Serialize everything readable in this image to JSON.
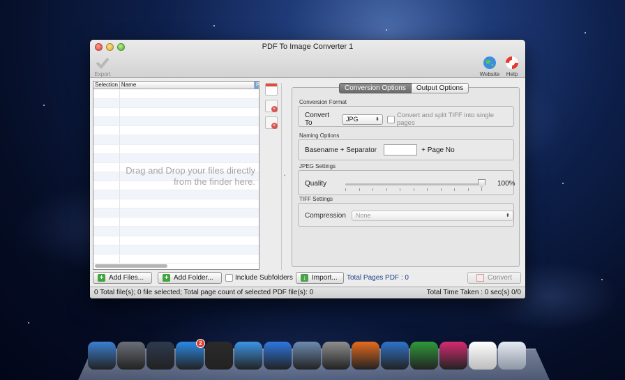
{
  "window": {
    "title": "PDF To Image Converter 1"
  },
  "toolbar": {
    "export_label": "Export",
    "website_label": "Website",
    "help_label": "Help"
  },
  "file_list": {
    "columns": [
      "Selection",
      "Name",
      "P"
    ],
    "drop_hint": "Drag and Drop your files directly from the finder here."
  },
  "tabs": [
    {
      "label": "Conversion Options",
      "active": true
    },
    {
      "label": "Output Options",
      "active": false
    }
  ],
  "conversion_format": {
    "group_label": "Conversion Format",
    "convert_to_label": "Convert To",
    "format_value": "JPG",
    "split_tiff_label": "Convert and split TIFF into single pages",
    "split_tiff_checked": false
  },
  "naming_options": {
    "group_label": "Naming Options",
    "basename_label": "Basename + Separator",
    "basename_value": "",
    "page_no_label": "+ Page No"
  },
  "jpeg_settings": {
    "group_label": "JPEG Settings",
    "quality_label": "Quality",
    "quality_value": 100,
    "quality_text": "100%"
  },
  "tiff_settings": {
    "group_label": "TIFF Settings",
    "compression_label": "Compression",
    "compression_value": "None"
  },
  "bottom_bar": {
    "add_files_label": "Add Files...",
    "add_folder_label": "Add Folder...",
    "include_subfolders_label": "Include Subfolders",
    "include_subfolders_checked": false,
    "import_label": "Import...",
    "total_pages_label": "Total Pages PDF : 0",
    "convert_label": "Convert"
  },
  "status_bar": {
    "left_text": "0 Total file(s); 0 file selected; Total page count of selected PDF file(s): 0",
    "right_text": "Total Time Taken : 0 sec(s) 0/0"
  },
  "dock": {
    "items": [
      {
        "name": "finder",
        "color": "#3b7fd1"
      },
      {
        "name": "launchpad",
        "color": "#6b6f78"
      },
      {
        "name": "mission-control",
        "color": "#2d3a4f"
      },
      {
        "name": "app-store",
        "color": "#2b8ae6",
        "badge": "2"
      },
      {
        "name": "dashboard",
        "color": "#2a2a2a"
      },
      {
        "name": "safari",
        "color": "#3d95e6"
      },
      {
        "name": "itunes",
        "color": "#2e77e0"
      },
      {
        "name": "iphoto",
        "color": "#6d8bb0"
      },
      {
        "name": "system-preferences",
        "color": "#8e8e8e"
      },
      {
        "name": "firefox",
        "color": "#e66b1e"
      },
      {
        "name": "word",
        "color": "#2f73c9"
      },
      {
        "name": "excel",
        "color": "#2f9a3a"
      },
      {
        "name": "app-heart",
        "color": "#d62b6f"
      },
      {
        "name": "pdf-converter",
        "color": "#d8d8d8"
      },
      {
        "name": "trash",
        "color": "#b9c0cc"
      }
    ]
  }
}
